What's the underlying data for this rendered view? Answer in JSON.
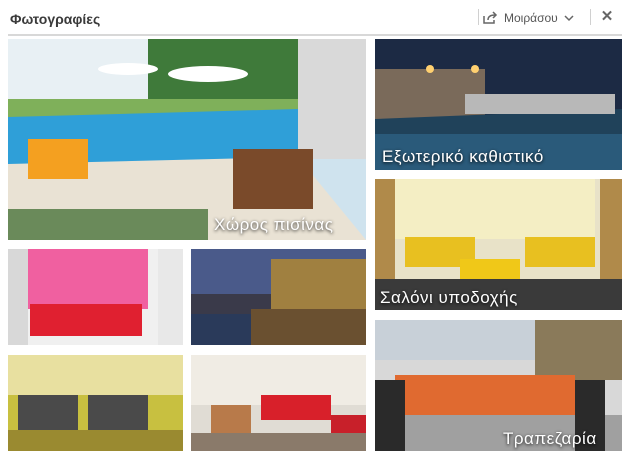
{
  "header": {
    "title": "Φωτογραφίες",
    "share_label": "Μοιράσου",
    "close_glyph": "✕"
  },
  "photos": [
    {
      "caption": "Χώρος πισίνας"
    },
    {
      "caption": "Εξωτερικό καθιστικό"
    },
    {
      "caption": "Σαλόνι υποδοχής"
    },
    {
      "caption": "Τραπεζαρία"
    }
  ],
  "colors": {
    "header_text": "#3a3a3a",
    "caption_text": "#ffffff"
  }
}
